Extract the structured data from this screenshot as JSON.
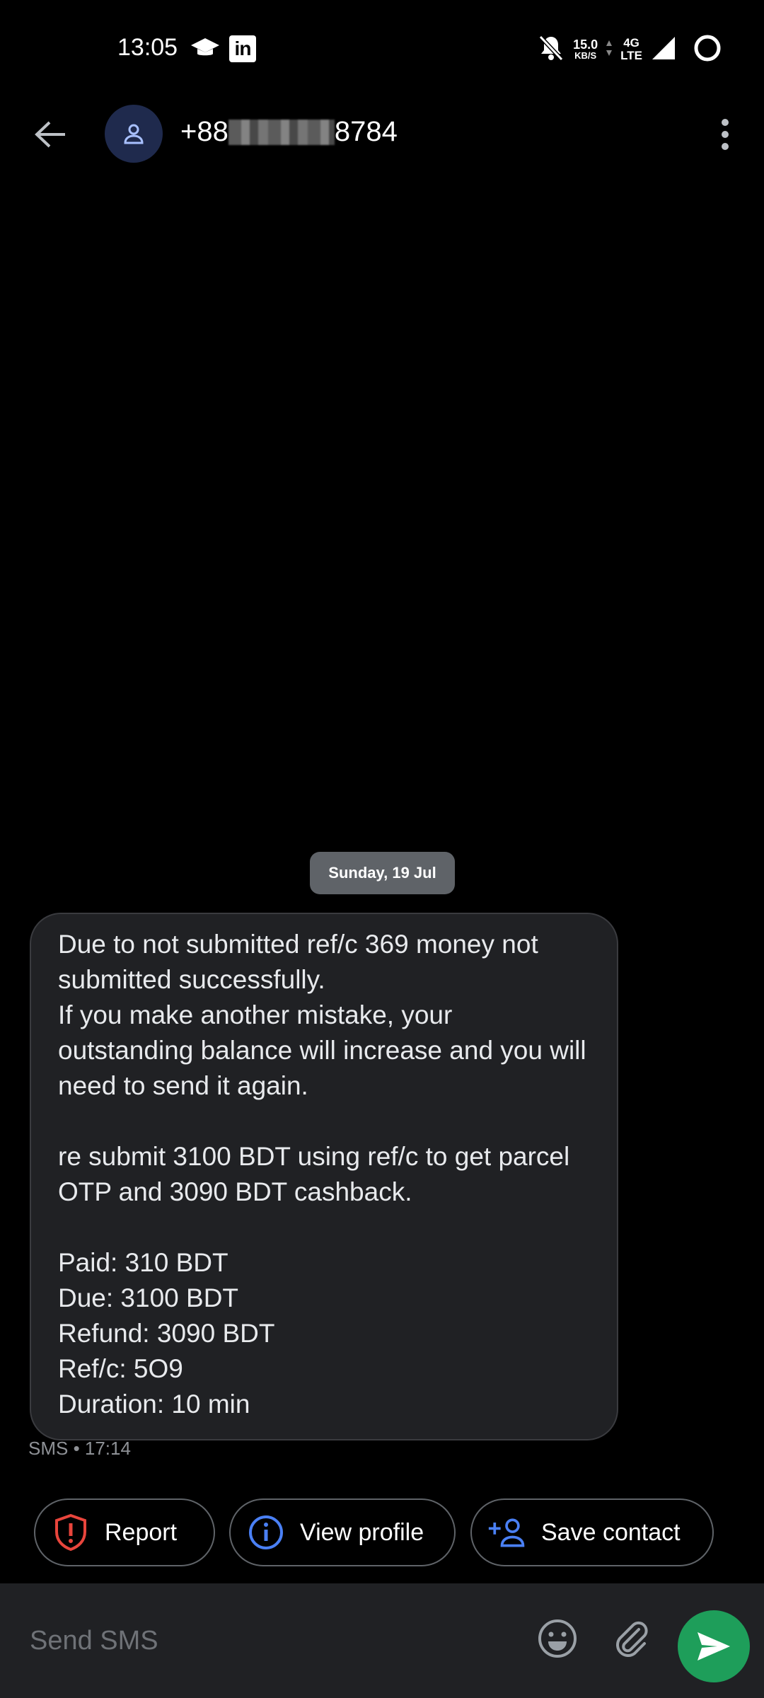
{
  "status_bar": {
    "time": "13:05",
    "net_speed_value": "15.0",
    "net_speed_unit": "KB/S",
    "network_type_top": "4G",
    "network_type_bottom": "LTE",
    "icons": [
      "graduation-cap-icon",
      "linkedin-icon",
      "bell-off-icon",
      "signal-icon",
      "battery-ring-icon"
    ]
  },
  "header": {
    "number_prefix": "+88",
    "number_suffix": "8784",
    "avatar_icon": "person-icon",
    "colors": {
      "avatar_bg": "#1f2a4d"
    }
  },
  "conversation": {
    "date_divider": "Sunday, 19 Jul",
    "message": {
      "text": "Due to not submitted ref/c 369 money not submitted successfully.\nIf you make another mistake, your outstanding balance will increase and you will need to send it again.\n\nre submit 3100 BDT using ref/c to get parcel OTP and 3090 BDT cashback.\n\nPaid: 310 BDT\nDue: 3100 BDT\nRefund: 3090 BDT\nRef/c: 5O9\nDuration: 10 min",
      "meta": "SMS • 17:14"
    }
  },
  "actions": {
    "report": "Report",
    "view_profile": "View profile",
    "save_contact": "Save contact",
    "colors": {
      "report": "#e8453c",
      "profile": "#4a80f5",
      "save": "#4a80f5"
    }
  },
  "composer": {
    "placeholder": "Send SMS",
    "colors": {
      "send": "#1e9e5a"
    }
  }
}
